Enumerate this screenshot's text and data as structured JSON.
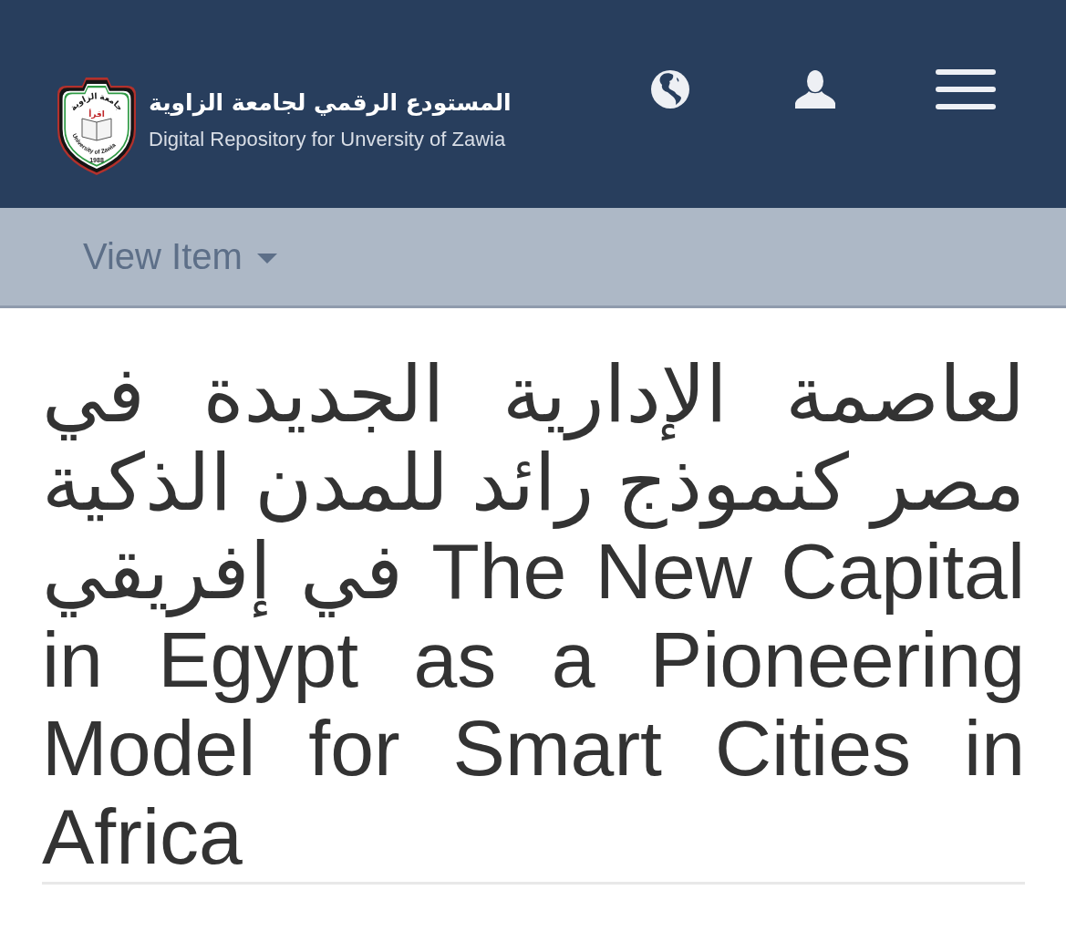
{
  "header": {
    "logo": {
      "arabic_name": "جامعة الزاوية",
      "book_word": "اقرأ",
      "english_name": "University of Zawia",
      "year": "1988"
    },
    "title": "المستودع الرقمي لجامعة الزاوية",
    "subtitle": "Digital Repository for Unversity of Zawia"
  },
  "breadcrumb": {
    "label": "View Item"
  },
  "item": {
    "title": "لعاصمة الإدارية الجديدة في مصر كنموذج رائد للمدن الذكية في إفريقي The New Capital in Egypt as a Pioneering Model for Smart Cities in Africa"
  }
}
